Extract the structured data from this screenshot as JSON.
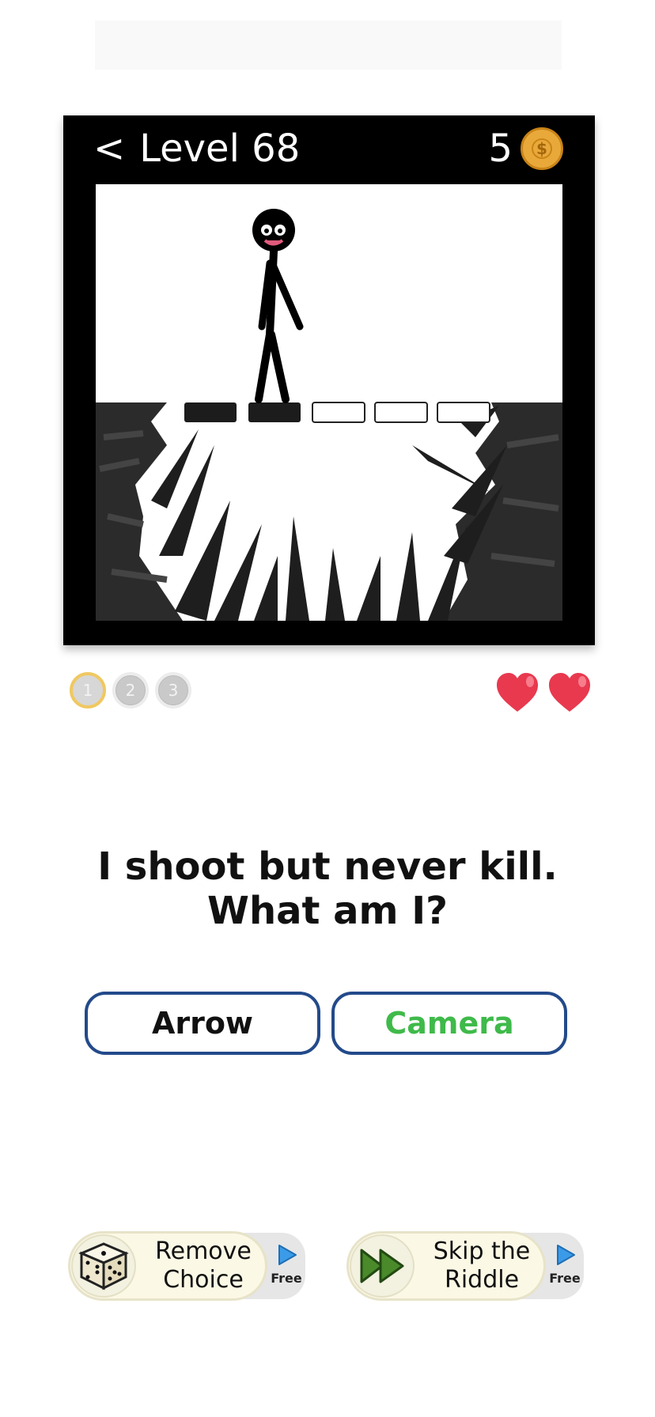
{
  "header": {
    "back_chevron": "<",
    "level_label": "Level 68",
    "coins": "5",
    "coin_symbol": "$",
    "coin_icon": "dollar-coin-icon"
  },
  "scene": {
    "bridge_total_planks": 5,
    "bridge_filled_planks": 2
  },
  "progress": {
    "steps": [
      "1",
      "2",
      "3"
    ],
    "current": 1
  },
  "lives": {
    "count": 2,
    "color": "#e8394f"
  },
  "question": {
    "line1": "I shoot but never kill.",
    "line2": "What am I?"
  },
  "answers": [
    {
      "label": "Arrow",
      "color": "#111111"
    },
    {
      "label": "Camera",
      "color": "#3fba4a"
    }
  ],
  "powerups": [
    {
      "line1": "Remove",
      "line2": "Choice",
      "tag": "Free",
      "icon": "dice-icon"
    },
    {
      "line1": "Skip the",
      "line2": "Riddle",
      "tag": "Free",
      "icon": "fast-forward-icon"
    }
  ],
  "colors": {
    "frame": "#000000",
    "answer_border": "#234a8a",
    "correct": "#3fba4a",
    "coin": "#e9a93a"
  }
}
